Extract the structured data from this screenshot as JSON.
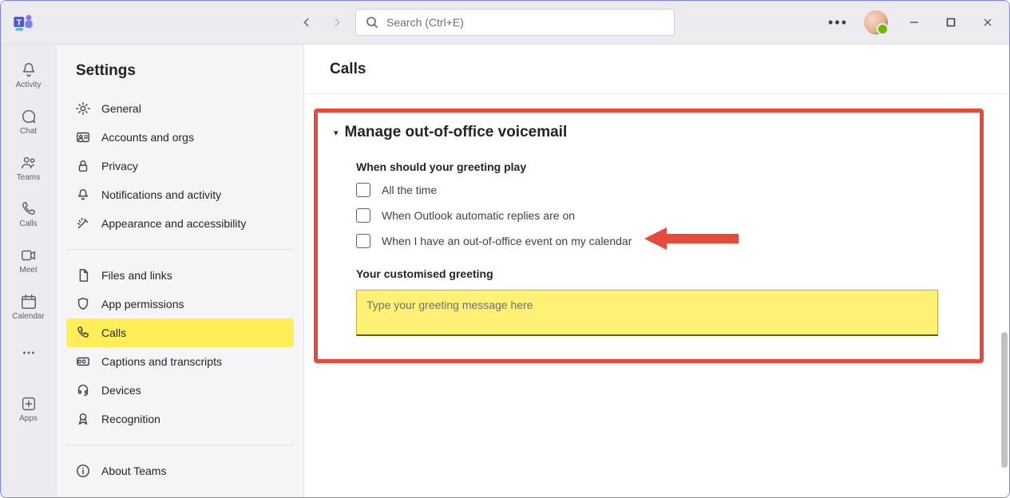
{
  "titlebar": {
    "search_placeholder": "Search (Ctrl+E)"
  },
  "rail": {
    "items": [
      {
        "id": "activity",
        "label": "Activity"
      },
      {
        "id": "chat",
        "label": "Chat"
      },
      {
        "id": "teams",
        "label": "Teams"
      },
      {
        "id": "calls",
        "label": "Calls"
      },
      {
        "id": "meet",
        "label": "Meet"
      },
      {
        "id": "calendar",
        "label": "Calendar"
      },
      {
        "id": "more",
        "label": ""
      },
      {
        "id": "apps",
        "label": "Apps"
      }
    ]
  },
  "settings": {
    "title": "Settings",
    "groups": {
      "a": [
        {
          "label": "General"
        },
        {
          "label": "Accounts and orgs"
        },
        {
          "label": "Privacy"
        },
        {
          "label": "Notifications and activity"
        },
        {
          "label": "Appearance and accessibility"
        }
      ],
      "b": [
        {
          "label": "Files and links"
        },
        {
          "label": "App permissions"
        },
        {
          "label": "Calls",
          "active": true
        },
        {
          "label": "Captions and transcripts"
        },
        {
          "label": "Devices"
        },
        {
          "label": "Recognition"
        }
      ],
      "c": [
        {
          "label": "About Teams"
        }
      ]
    }
  },
  "main": {
    "title": "Calls",
    "section_title": "Manage out-of-office voicemail",
    "greeting_question": "When should your greeting play",
    "options": [
      "All the time",
      "When Outlook automatic replies are on",
      "When I have an out-of-office event on my calendar"
    ],
    "greeting_label": "Your customised greeting",
    "greeting_placeholder": "Type your greeting message here"
  },
  "colors": {
    "highlight_border": "#e64a3b",
    "active_bg": "#ffee58",
    "textarea_bg": "#fff176"
  }
}
